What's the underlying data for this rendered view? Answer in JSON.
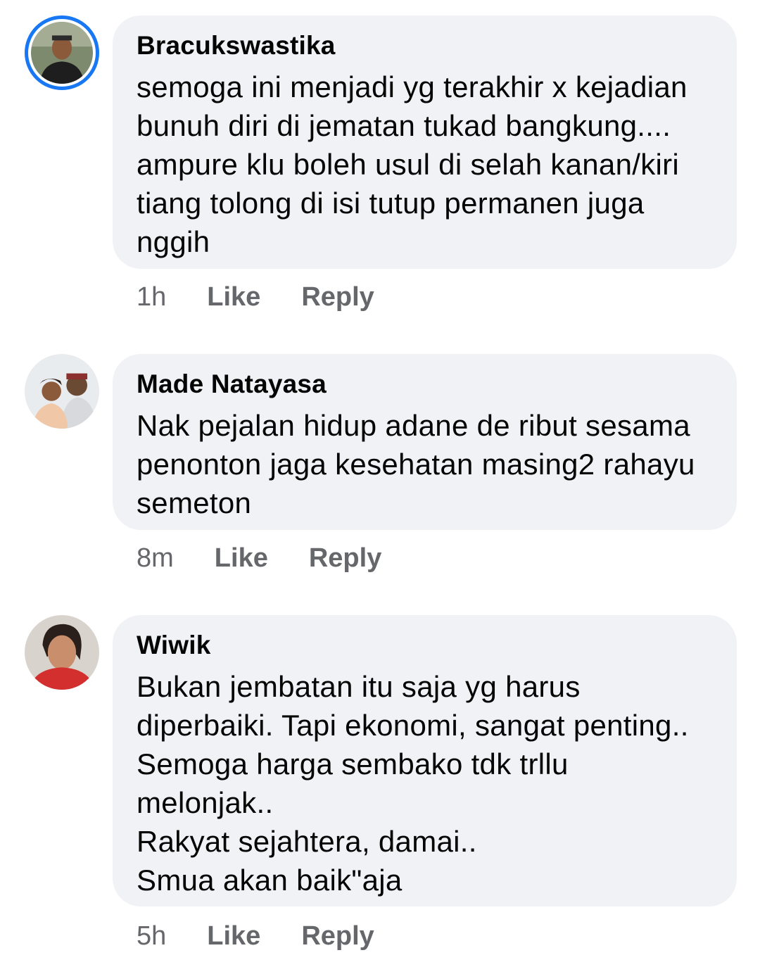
{
  "comments": [
    {
      "author": "Bracukswastika",
      "text": "semoga ini menjadi yg terakhir x kejadian\nbunuh diri di jematan tukad bangkung....\nampure klu boleh usul di selah kanan/kiri\ntiang tolong di isi tutup permanen juga\nnggih",
      "time": "1h",
      "like_label": "Like",
      "reply_label": "Reply"
    },
    {
      "author": "Made Natayasa",
      "text": "Nak pejalan hidup adane de ribut sesama\npenonton jaga kesehatan masing2 rahayu\nsemeton",
      "time": "8m",
      "like_label": "Like",
      "reply_label": "Reply"
    },
    {
      "author": "Wiwik",
      "text": "Bukan jembatan itu saja yg harus\ndiperbaiki. Tapi ekonomi, sangat penting..\nSemoga harga sembako tdk trllu\nmelonjak..\nRakyat sejahtera, damai..\nSmua akan baik\"aja",
      "time": "5h",
      "like_label": "Like",
      "reply_label": "Reply"
    }
  ],
  "colors": {
    "bubble": "#f0f2f5",
    "story_ring": "#1877f2",
    "meta_text": "#65676b"
  }
}
